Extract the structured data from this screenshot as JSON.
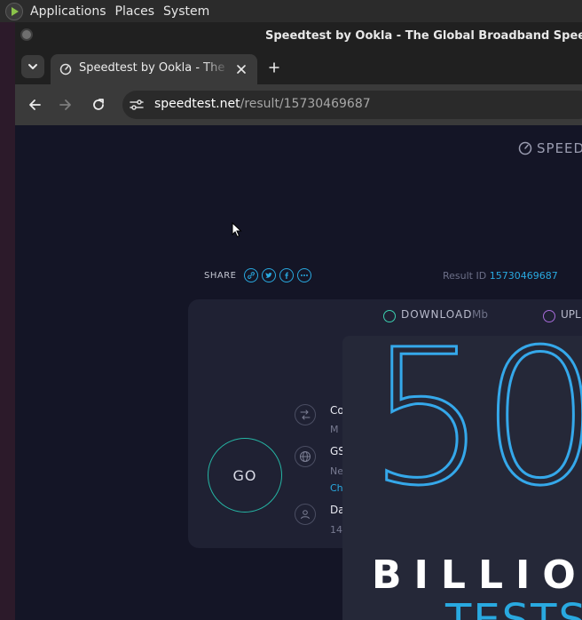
{
  "panel": {
    "menus": [
      "Applications",
      "Places",
      "System"
    ]
  },
  "window": {
    "title": "Speedtest by Ookla - The Global Broadband Speed Test - G"
  },
  "tab": {
    "title": "Speedtest by Ookla - The Global Broadband Speed Test"
  },
  "address_bar": {
    "host": "speedtest.net",
    "path": "/result/15730469687"
  },
  "page": {
    "brand": "SPEED",
    "share_label": "SHARE",
    "result_id_label": "Result ID",
    "result_id": "15730469687",
    "download_label": "DOWNLOAD",
    "download_unit": "Mb",
    "upload_label": "UPL",
    "go_label": "GO",
    "info": [
      {
        "title": "Co",
        "sub": "M",
        "icon": "connections-icon"
      },
      {
        "title": "GS",
        "sub": "Ne",
        "link": "Ch",
        "icon": "globe-icon"
      },
      {
        "title": "Da",
        "sub": "14",
        "icon": "person-icon"
      }
    ]
  },
  "ad": {
    "number": "50",
    "line1": "BILLIO",
    "line2": "TESTS"
  },
  "colors": {
    "accent_blue": "#29a9e0",
    "go_ring": "#25b5a4",
    "page_bg": "#141526",
    "card_bg": "#1f2133"
  }
}
